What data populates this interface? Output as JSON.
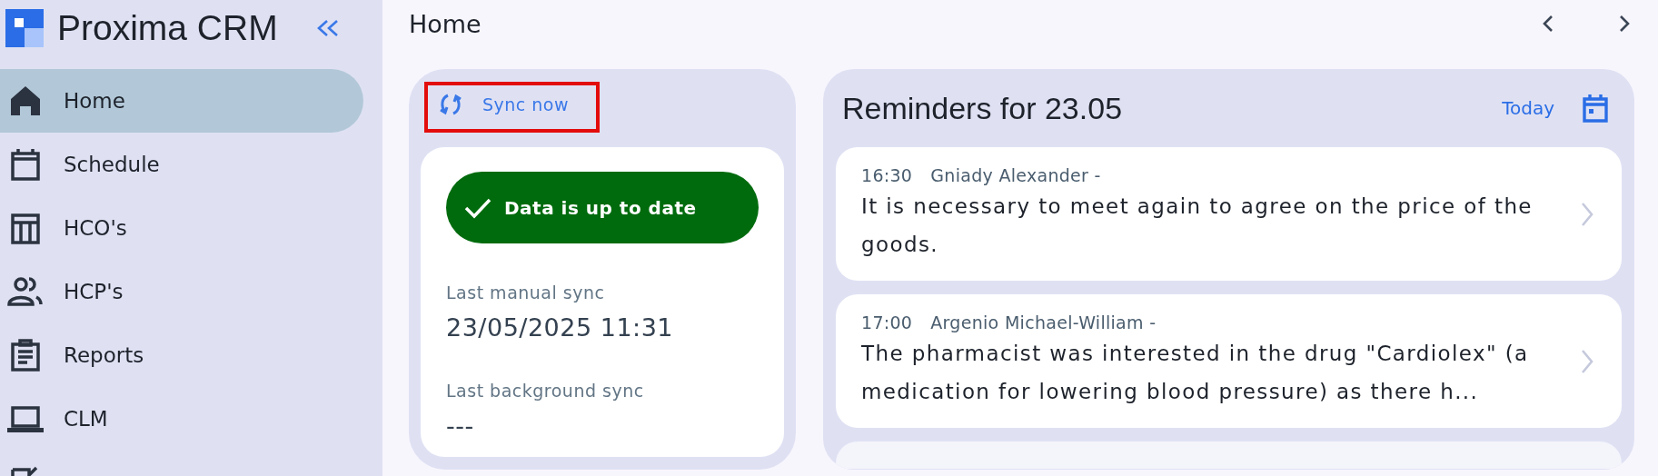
{
  "sidebar": {
    "app_title": "Proxima CRM",
    "items": [
      {
        "label": "Home",
        "selected": true
      },
      {
        "label": "Schedule",
        "selected": false
      },
      {
        "label": "HCO's",
        "selected": false
      },
      {
        "label": "HCP's",
        "selected": false
      },
      {
        "label": "Reports",
        "selected": false
      },
      {
        "label": "CLM",
        "selected": false
      },
      {
        "selected": false
      }
    ]
  },
  "header": {
    "title": "Home"
  },
  "sync_card": {
    "sync_button": {
      "label": "Sync now",
      "highlighted": true
    },
    "status": {
      "label": "Data is up to date",
      "ok": true
    },
    "fields": [
      {
        "label": "Last manual sync",
        "value": "23/05/2025 11:31"
      },
      {
        "label": "Last background sync",
        "value": "---"
      }
    ]
  },
  "reminders": {
    "title": "Reminders for 23.05",
    "today_button": "Today",
    "items": [
      {
        "time": "16:30",
        "person": "Gniady Alexander -",
        "text": "It is necessary to meet again to agree on the price of the goods."
      },
      {
        "time": "17:00",
        "person": "Argenio Michael-William -",
        "text": "The pharmacist was interested in the drug \"Cardiolex\" (a medication for lowering blood pressure) as there h..."
      }
    ],
    "more_below": true
  }
}
